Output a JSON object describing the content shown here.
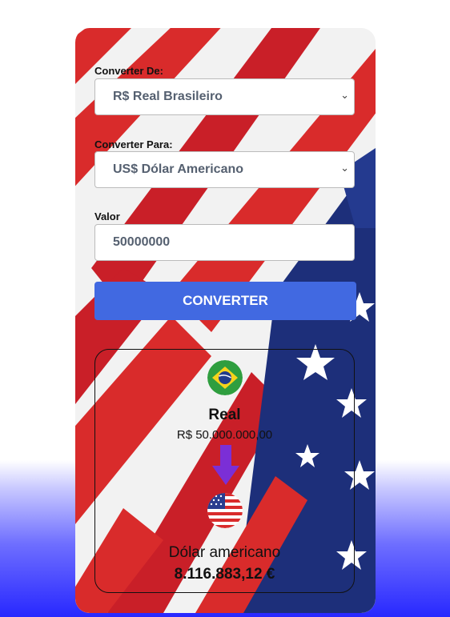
{
  "form": {
    "from_label": "Converter De:",
    "from_value": "R$ Real Brasileiro",
    "to_label": "Converter Para:",
    "to_value": "US$ Dólar Americano",
    "amount_label": "Valor",
    "amount_value": "50000000",
    "convert_label": "CONVERTER"
  },
  "result": {
    "from_currency": "Real",
    "from_amount": "R$ 50.000.000,00",
    "to_currency": "Dólar americano",
    "to_amount": "8.116.883,12 €"
  },
  "colors": {
    "accent": "#4169e1",
    "arrow": "#7b2fd6",
    "flag_red": "#d92b2b",
    "flag_blue": "#1d2f7a"
  }
}
